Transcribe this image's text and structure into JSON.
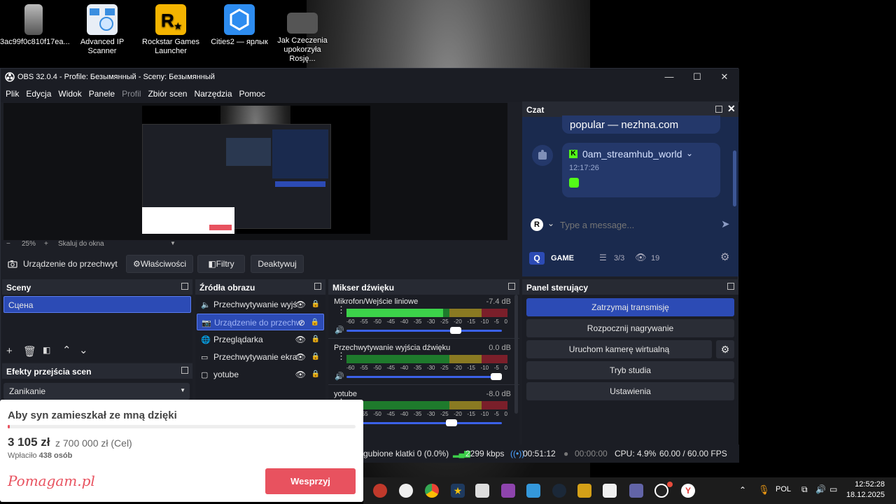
{
  "desktop": {
    "icons": [
      {
        "label": "3ac99f0c810f17ea...",
        "icon": "image-file-icon"
      },
      {
        "label": "Advanced IP Scanner",
        "icon": "network-scanner-icon"
      },
      {
        "label": "Rockstar Games Launcher",
        "icon": "rockstar-icon"
      },
      {
        "label": "Cities2 — ярлык",
        "icon": "cities-icon"
      },
      {
        "label": "Jak Czeczenia upokorzyła Rosję...",
        "icon": "video-file-icon"
      }
    ]
  },
  "window": {
    "title": "OBS 32.0.4 - Profile: Безымянный - Sceny: Безымянный",
    "minimize": "—",
    "maximize": "☐",
    "close": "✕"
  },
  "menu": [
    "Plik",
    "Edycja",
    "Widok",
    "Panele",
    "Profil",
    "Zbiór scen",
    "Narzędzia",
    "Pomoc"
  ],
  "preview": {
    "zoom_minus": "−",
    "zoom_value": "25%",
    "zoom_plus": "+",
    "scale_label": "Skaluj do okna"
  },
  "source_toolbar": {
    "selected_source": "Urządzenie do przechwyt",
    "properties": "Właściwości",
    "filters": "Filtry",
    "deactivate": "Deaktywuj"
  },
  "scenes": {
    "title": "Sceny",
    "items": [
      "Сцена"
    ]
  },
  "transitions": {
    "title": "Efekty przejścia scen",
    "selected": "Zanikanie"
  },
  "sources": {
    "title": "Źródła obrazu",
    "items": [
      {
        "label": "Przechwytywanie wyjś",
        "icon": "speaker-icon",
        "visible": true,
        "selected": false
      },
      {
        "label": "Urządzenie do przechw",
        "icon": "camera-icon",
        "visible": false,
        "selected": true
      },
      {
        "label": "Przeglądarka",
        "icon": "globe-icon",
        "visible": true,
        "selected": false
      },
      {
        "label": "Przechwytywanie ekra",
        "icon": "monitor-icon",
        "visible": true,
        "selected": false
      },
      {
        "label": "yotube",
        "icon": "window-icon",
        "visible": true,
        "selected": false
      }
    ]
  },
  "mixer": {
    "title": "Mikser dźwięku",
    "ticks": [
      "-60",
      "-55",
      "-50",
      "-45",
      "-40",
      "-35",
      "-30",
      "-25",
      "-20",
      "-15",
      "-10",
      "-5",
      "0"
    ],
    "channels": [
      {
        "name": "Mikrofon/Wejście liniowe",
        "db": "-7.4 dB",
        "level": 0.6,
        "volume": 0.72
      },
      {
        "name": "Przechwytywanie wyjścia dźwięku",
        "db": "0.0 dB",
        "level": 0.0,
        "volume": 1.0
      },
      {
        "name": "yotube",
        "db": "-8.0 dB",
        "level": 0.0,
        "volume": 0.69
      }
    ]
  },
  "controls": {
    "title": "Panel sterujący",
    "stop_stream": "Zatrzymaj transmisję",
    "start_recording": "Rozpocznij nagrywanie",
    "virtual_camera": "Uruchom kamerę wirtualną",
    "studio_mode": "Tryb studia",
    "settings": "Ustawienia"
  },
  "chat": {
    "title": "Czat",
    "prev_message": "popular — nezhna.com",
    "username": "0am_streamhub_world",
    "time": "12:17:26",
    "placeholder": "Type a message...",
    "category": "GAME",
    "slots": "3/3",
    "viewers": "19"
  },
  "status": {
    "dropped": "gubione klatki 0 (0.0%)",
    "bitrate": "2299 kbps",
    "stream_time": "00:51:12",
    "rec_time": "00:00:00",
    "cpu": "CPU: 4.9%",
    "fps": "60.00 / 60.00 FPS"
  },
  "donation": {
    "title": "Aby syn zamieszkał ze mną dzięki",
    "amount": "3 105 zł",
    "goal": "z 700 000 zł (Cel)",
    "paid_label": "Wpłaciło",
    "paid_count": "438 osób",
    "progress": 0.0044,
    "brand": "Pomagam.pl",
    "support_button": "Wesprzyj"
  },
  "taskbar": {
    "language": "POL",
    "time": "12:52:28",
    "date": "18.12.2025"
  },
  "colors": {
    "accent": "#2c4bb5",
    "brand_red": "#e8525f",
    "kick_green": "#53fc18"
  }
}
